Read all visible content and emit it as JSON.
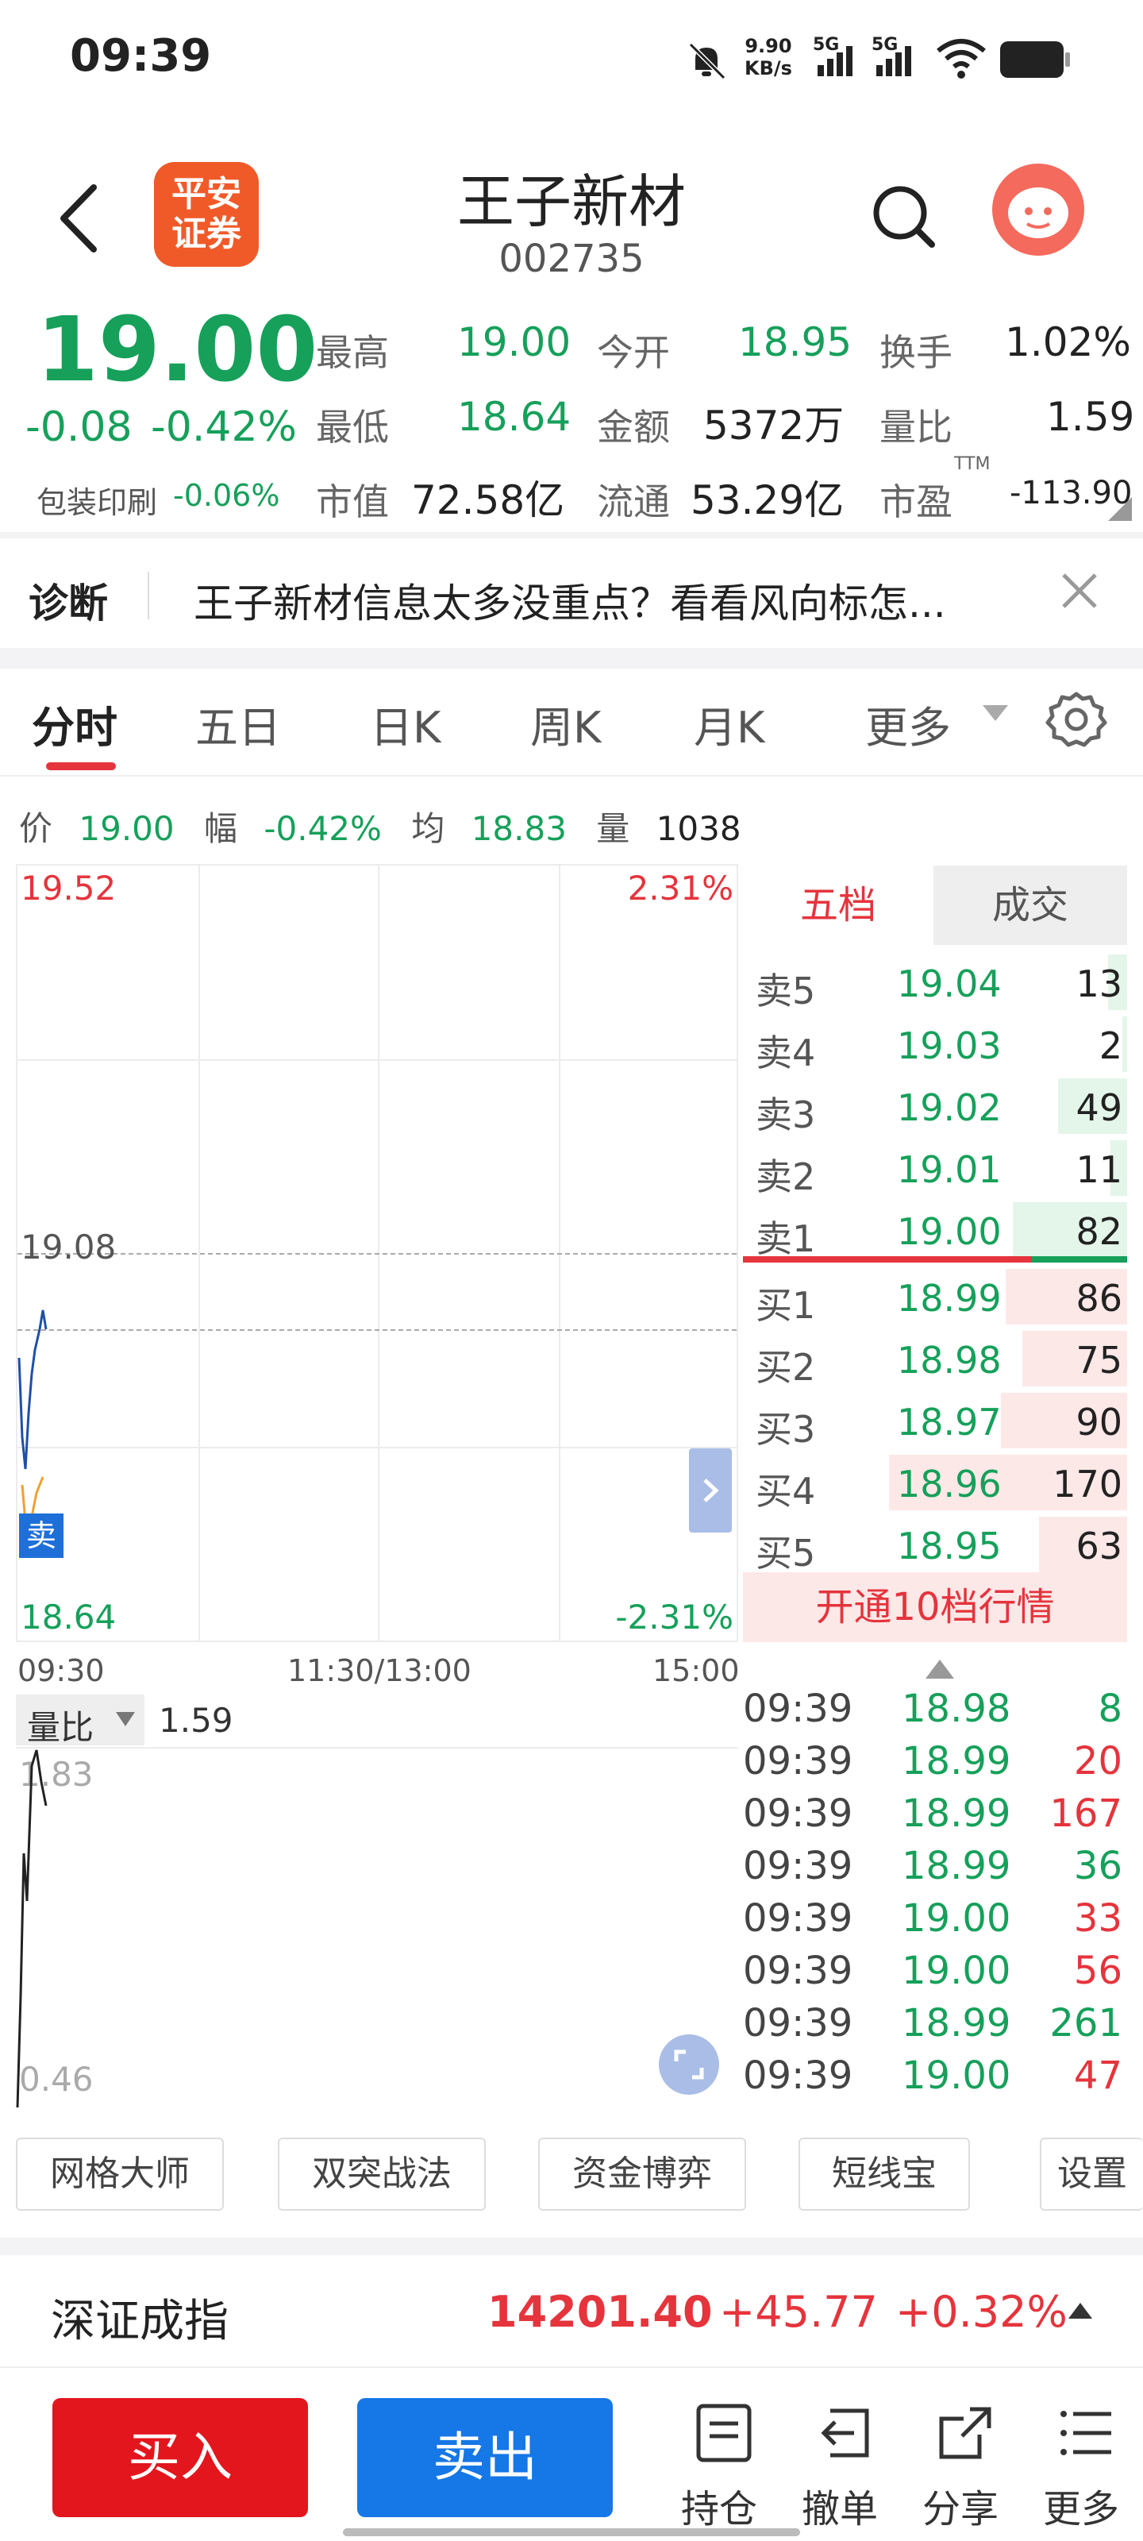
{
  "status_bar": {
    "time": "09:39",
    "net_speed_top": "9.90",
    "net_speed_bottom": "KB/s",
    "sig1": "5G",
    "sig2": "5G"
  },
  "header": {
    "title": "王子新材",
    "code": "002735",
    "logo_line1": "平安",
    "logo_line2": "证券"
  },
  "quote": {
    "price": "19.00",
    "change": "-0.08",
    "change_pct": "-0.42%",
    "sector": "包装印刷",
    "sector_pct": "-0.06%",
    "stats": [
      {
        "label": "最高",
        "value": "19.00"
      },
      {
        "label": "今开",
        "value": "18.95"
      },
      {
        "label": "换手",
        "value": "1.02%"
      },
      {
        "label": "最低",
        "value": "18.64"
      },
      {
        "label": "金额",
        "value": "5372万"
      },
      {
        "label": "量比",
        "value": "1.59"
      },
      {
        "label": "市值",
        "value": "72.58亿"
      },
      {
        "label": "流通",
        "value": "53.29亿"
      },
      {
        "label": "市盈",
        "value": "-113.90"
      }
    ],
    "ttm": "TTM"
  },
  "diagnose": {
    "label": "诊断",
    "text": "王子新材信息太多没重点？看看风向标怎..."
  },
  "tabs": [
    "分时",
    "五日",
    "日K",
    "周K",
    "月K",
    "更多"
  ],
  "info_bar": {
    "price_label": "价",
    "price": "19.00",
    "range_label": "幅",
    "range": "-0.42%",
    "avg_label": "均",
    "avg": "18.83",
    "vol_label": "量",
    "vol": "1038"
  },
  "chart": {
    "y_top": "19.52",
    "y_top_pct": "2.31%",
    "y_mid": "19.08",
    "y_bottom": "18.64",
    "y_bottom_pct": "-2.31%",
    "x_labels": [
      "09:30",
      "11:30/13:00",
      "15:00"
    ],
    "sell_marker": "卖",
    "vol_ratio_label": "量比",
    "vol_ratio_value": "1.59",
    "vol_top": "1.83",
    "vol_bottom": "0.46"
  },
  "orderbook": {
    "tab_active": "五档",
    "tab_other": "成交",
    "asks": [
      {
        "label": "卖5",
        "price": "19.04",
        "vol": "13",
        "depth": 0.08
      },
      {
        "label": "卖4",
        "price": "19.03",
        "vol": "2",
        "depth": 0.02
      },
      {
        "label": "卖3",
        "price": "19.02",
        "vol": "49",
        "depth": 0.29
      },
      {
        "label": "卖2",
        "price": "19.01",
        "vol": "11",
        "depth": 0.07
      },
      {
        "label": "卖1",
        "price": "19.00",
        "vol": "82",
        "depth": 0.48
      }
    ],
    "bids": [
      {
        "label": "买1",
        "price": "18.99",
        "vol": "86",
        "depth": 0.51
      },
      {
        "label": "买2",
        "price": "18.98",
        "vol": "75",
        "depth": 0.44
      },
      {
        "label": "买3",
        "price": "18.97",
        "vol": "90",
        "depth": 0.53
      },
      {
        "label": "买4",
        "price": "18.96",
        "vol": "170",
        "depth": 1.0
      },
      {
        "label": "买5",
        "price": "18.95",
        "vol": "63",
        "depth": 0.37
      }
    ],
    "upgrade": "开通10档行情"
  },
  "trades": [
    {
      "time": "09:39",
      "price": "18.98",
      "vol": "8",
      "side": "sell"
    },
    {
      "time": "09:39",
      "price": "18.99",
      "vol": "20",
      "side": "buy"
    },
    {
      "time": "09:39",
      "price": "18.99",
      "vol": "167",
      "side": "buy"
    },
    {
      "time": "09:39",
      "price": "18.99",
      "vol": "36",
      "side": "sell"
    },
    {
      "time": "09:39",
      "price": "19.00",
      "vol": "33",
      "side": "buy"
    },
    {
      "time": "09:39",
      "price": "19.00",
      "vol": "56",
      "side": "buy"
    },
    {
      "time": "09:39",
      "price": "18.99",
      "vol": "261",
      "side": "sell"
    },
    {
      "time": "09:39",
      "price": "19.00",
      "vol": "47",
      "side": "buy"
    }
  ],
  "tools": [
    "网格大师",
    "双突战法",
    "资金博弈",
    "短线宝",
    "设置"
  ],
  "index_bar": {
    "name": "深证成指",
    "value": "14201.40",
    "change": "+45.77",
    "pct": "+0.32%"
  },
  "bottom": {
    "buy": "买入",
    "sell": "卖出",
    "actions": [
      "持仓",
      "撤单",
      "分享",
      "更多"
    ]
  },
  "colors": {
    "up": "#e5343c",
    "down": "#16a05a",
    "buy_btn": "#e3161e",
    "sell_btn": "#1677e6"
  }
}
